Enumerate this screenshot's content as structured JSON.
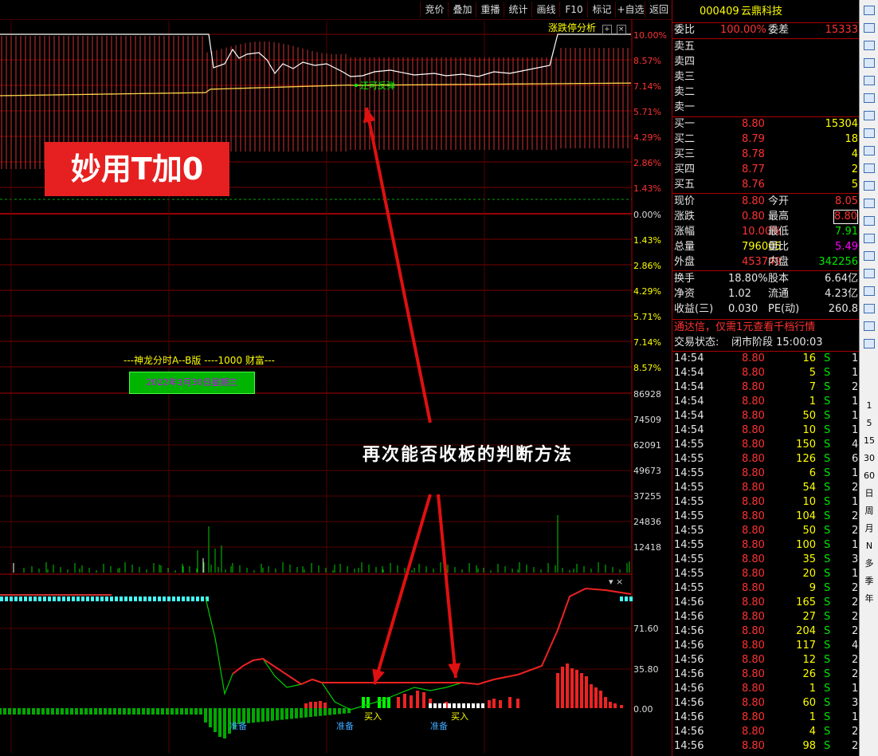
{
  "toolbar": {
    "buttons": [
      "竞价",
      "叠加",
      "重播",
      "统计",
      "画线",
      "F10",
      "标记",
      "+自选",
      "返回"
    ]
  },
  "chart": {
    "zdt_label": "涨跌停分析",
    "price_axis_labels": [
      "10.00%",
      "8.57%",
      "7.14%",
      "5.71%",
      "4.29%",
      "2.86%",
      "1.43%",
      "0.00%",
      "1.43%",
      "2.86%",
      "4.29%",
      "5.71%",
      "7.14%",
      "8.57%"
    ],
    "volume_axis_labels": [
      "86928",
      "74509",
      "62091",
      "49673",
      "37255",
      "24836",
      "12418"
    ],
    "indicator_axis_labels": [
      "71.60",
      "35.80",
      "0.00"
    ],
    "annotation_back": "还可反弹",
    "indicator_name": "---神龙分时A--B版 ----1000 财富---",
    "green_box_text": "2022年3月30日星期三",
    "signals": [
      {
        "text": "准备",
        "color": "#3fa9ff"
      },
      {
        "text": "准备",
        "color": "#3fa9ff"
      },
      {
        "text": "买入",
        "color": "#ffff00"
      },
      {
        "text": "准备",
        "color": "#3fa9ff"
      },
      {
        "text": "买入",
        "color": "#ffff00"
      }
    ]
  },
  "overlay": {
    "title": "妙用T加0",
    "annotation": "再次能否收板的判断方法"
  },
  "right_panel": {
    "code": "000409",
    "name": "云鼎科技",
    "weibi_label": "委比",
    "weibi_value": "100.00%",
    "weicha_label": "委差",
    "weicha_value": "15333",
    "sell_labels": [
      "卖五",
      "卖四",
      "卖三",
      "卖二",
      "卖一"
    ],
    "buys": [
      {
        "label": "买一",
        "price": "8.80",
        "vol": "15304"
      },
      {
        "label": "买二",
        "price": "8.79",
        "vol": "18"
      },
      {
        "label": "买三",
        "price": "8.78",
        "vol": "4"
      },
      {
        "label": "买四",
        "price": "8.77",
        "vol": "2"
      },
      {
        "label": "买五",
        "price": "8.76",
        "vol": "5"
      }
    ],
    "stats": [
      {
        "l1": "现价",
        "v1": "8.80",
        "c1": "red",
        "l2": "今开",
        "v2": "8.05",
        "c2": "red"
      },
      {
        "l1": "涨跌",
        "v1": "0.80",
        "c1": "red",
        "l2": "最高",
        "v2": "8.80",
        "c2": "red"
      },
      {
        "l1": "涨幅",
        "v1": "10.00%",
        "c1": "red",
        "l2": "最低",
        "v2": "7.91",
        "c2": "green"
      },
      {
        "l1": "总量",
        "v1": "796005",
        "c1": "yellow",
        "l2": "量比",
        "v2": "5.49",
        "c2": "magenta"
      },
      {
        "l1": "外盘",
        "v1": "453749",
        "c1": "red",
        "l2": "内盘",
        "v2": "342256",
        "c2": "green"
      }
    ],
    "stats2": [
      {
        "l1": "换手",
        "v1": "18.80%",
        "l2": "股本",
        "v2": "6.64亿"
      },
      {
        "l1": "净资",
        "v1": "1.02",
        "l2": "流通",
        "v2": "4.23亿"
      },
      {
        "l1": "收益(三)",
        "v1": "0.030",
        "l2": "PE(动)",
        "v2": "260.8"
      }
    ],
    "promo": "通达信，仅需1元查看千档行情",
    "status_label": "交易状态:",
    "status_value": "闭市阶段 15:00:03",
    "ticks": [
      [
        "14:54",
        "8.80",
        "16",
        "S",
        "1"
      ],
      [
        "14:54",
        "8.80",
        "5",
        "S",
        "1"
      ],
      [
        "14:54",
        "8.80",
        "7",
        "S",
        "2"
      ],
      [
        "14:54",
        "8.80",
        "1",
        "S",
        "1"
      ],
      [
        "14:54",
        "8.80",
        "50",
        "S",
        "1"
      ],
      [
        "14:54",
        "8.80",
        "10",
        "S",
        "1"
      ],
      [
        "14:55",
        "8.80",
        "150",
        "S",
        "4"
      ],
      [
        "14:55",
        "8.80",
        "126",
        "S",
        "6"
      ],
      [
        "14:55",
        "8.80",
        "6",
        "S",
        "1"
      ],
      [
        "14:55",
        "8.80",
        "54",
        "S",
        "2"
      ],
      [
        "14:55",
        "8.80",
        "10",
        "S",
        "1"
      ],
      [
        "14:55",
        "8.80",
        "104",
        "S",
        "2"
      ],
      [
        "14:55",
        "8.80",
        "50",
        "S",
        "2"
      ],
      [
        "14:55",
        "8.80",
        "100",
        "S",
        "1"
      ],
      [
        "14:55",
        "8.80",
        "35",
        "S",
        "3"
      ],
      [
        "14:55",
        "8.80",
        "20",
        "S",
        "1"
      ],
      [
        "14:55",
        "8.80",
        "9",
        "S",
        "2"
      ],
      [
        "14:56",
        "8.80",
        "165",
        "S",
        "2"
      ],
      [
        "14:56",
        "8.80",
        "27",
        "S",
        "2"
      ],
      [
        "14:56",
        "8.80",
        "204",
        "S",
        "2"
      ],
      [
        "14:56",
        "8.80",
        "117",
        "S",
        "4"
      ],
      [
        "14:56",
        "8.80",
        "12",
        "S",
        "2"
      ],
      [
        "14:56",
        "8.80",
        "26",
        "S",
        "2"
      ],
      [
        "14:56",
        "8.80",
        "1",
        "S",
        "1"
      ],
      [
        "14:56",
        "8.80",
        "60",
        "S",
        "3"
      ],
      [
        "14:56",
        "8.80",
        "1",
        "S",
        "1"
      ],
      [
        "14:56",
        "8.80",
        "4",
        "S",
        "2"
      ],
      [
        "14:56",
        "8.80",
        "98",
        "S",
        "2"
      ]
    ]
  },
  "sidebar": {
    "text_items": [
      "1",
      "5",
      "15",
      "30",
      "60",
      "日",
      "周",
      "月",
      "N",
      "多",
      "季",
      "年"
    ],
    "icons": [
      "back-arrow-icon",
      "up-icon",
      "down-icon",
      "list-icon",
      "grid-icon",
      "fundamentals-icon",
      "table-icon",
      "finance-icon",
      "f10-icon",
      "f12-icon",
      "depth-icon",
      "circle-icon",
      "chart1-icon",
      "chart2-icon",
      "chart3-icon",
      "percent-icon",
      "pencil-icon",
      "screen-icon",
      "f1-icon",
      "refresh-icon"
    ]
  }
}
